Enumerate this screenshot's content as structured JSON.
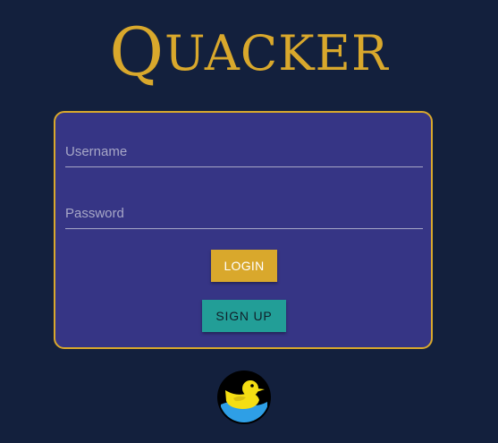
{
  "app": {
    "logo_first": "Q",
    "logo_rest": "UACKER"
  },
  "login_form": {
    "username_placeholder": "Username",
    "password_placeholder": "Password",
    "login_label": "LOGIN",
    "signup_label": "SIGN UP"
  },
  "colors": {
    "page_background": "#13203d",
    "card_background": "#363585",
    "accent_gold": "#d9a82c",
    "signup_teal": "#229e97",
    "duck_yellow": "#f5de13",
    "water_blue": "#2e9fe6"
  },
  "icons": {
    "footer_logo": "duck-icon"
  }
}
